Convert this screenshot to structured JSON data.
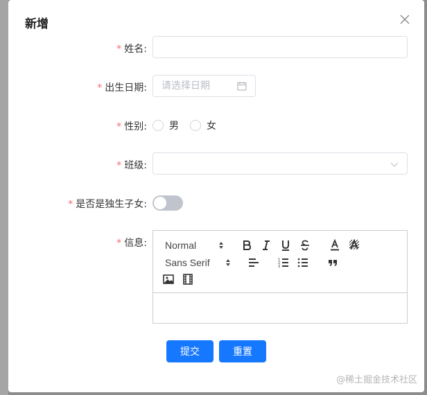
{
  "dialog": {
    "title": "新增",
    "fields": {
      "name_label": "姓名:",
      "birth_label": "出生日期:",
      "birth_placeholder": "请选择日期",
      "gender_label": "性别:",
      "gender_options": [
        "男",
        "女"
      ],
      "class_label": "班级:",
      "only_child_label": "是否是独生子女:",
      "info_label": "信息:"
    },
    "required_mark": "*",
    "editor": {
      "header_select": "Normal",
      "font_select": "Sans Serif"
    },
    "buttons": {
      "submit": "提交",
      "reset": "重置"
    }
  },
  "watermark": "@稀土掘金技术社区",
  "colors": {
    "primary": "#1677ff",
    "required": "#f56c6c",
    "border": "#dcdfe6",
    "switch_off": "#c0c4cc"
  },
  "only_child_switch_on": false,
  "icons": [
    "close-icon",
    "calendar-icon",
    "chevron-down-icon",
    "bold-icon",
    "italic-icon",
    "underline-icon",
    "strike-icon",
    "text-color-icon",
    "clear-format-icon",
    "align-icon",
    "ordered-list-icon",
    "bullet-list-icon",
    "blockquote-icon",
    "image-icon",
    "video-icon"
  ]
}
